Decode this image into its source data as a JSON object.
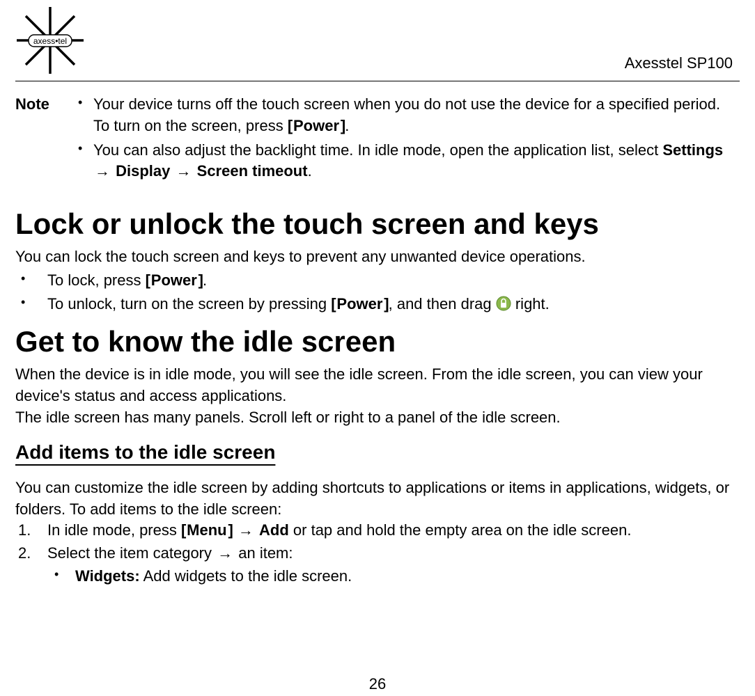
{
  "header": {
    "logo_text": "axess•tel",
    "model": "Axesstel SP100"
  },
  "note": {
    "label": "Note",
    "item1_a": "Your device turns off the touch screen when you do not use the device for a specified period. To turn on the screen, press ",
    "item1_key_l": "[",
    "item1_key": "Power",
    "item1_key_r": "]",
    "item1_c": ".",
    "item2_a": "You can also adjust the backlight time. In idle mode, open the application list, select ",
    "item2_settings": "Settings",
    "item2_display": "Display",
    "item2_timeout": "Screen timeout",
    "item2_end": "."
  },
  "arrow": "→",
  "h1_lock": "Lock or unlock the touch screen and keys",
  "lock_intro": "You can lock the touch screen and keys to prevent any unwanted device operations.",
  "lock_li1_a": "To lock, press ",
  "lock_li1_key_l": "[",
  "lock_li1_key": "Power",
  "lock_li1_key_r": "]",
  "lock_li1_end": ".",
  "lock_li2_a": "To unlock, turn on the screen by pressing ",
  "lock_li2_key_l": "[",
  "lock_li2_key": "Power",
  "lock_li2_key_r": "]",
  "lock_li2_b": ", and then drag ",
  "lock_li2_c": " right.",
  "h1_idle": "Get to know the idle screen",
  "idle_p1": "When the device is in idle mode, you will see the idle screen. From the idle screen, you can view your device's status and access applications.",
  "idle_p2": "The idle screen has many panels. Scroll left or right to a panel of the idle screen.",
  "h2_add": "Add items to the idle screen",
  "add_intro": "You can customize the idle screen by adding shortcuts to applications or items in applications, widgets, or folders. To add items to the idle screen:",
  "add_ol1_a": "In idle mode, press ",
  "add_ol1_key_l": "[",
  "add_ol1_key": "Menu",
  "add_ol1_key_r": "]",
  "add_ol1_add": "Add",
  "add_ol1_b": " or tap and hold the empty area on the idle screen.",
  "add_ol2_a": "Select the item category ",
  "add_ol2_b": " an item:",
  "add_nested_label": "Widgets:",
  "add_nested_text": " Add widgets to the idle screen.",
  "page_number": "26"
}
